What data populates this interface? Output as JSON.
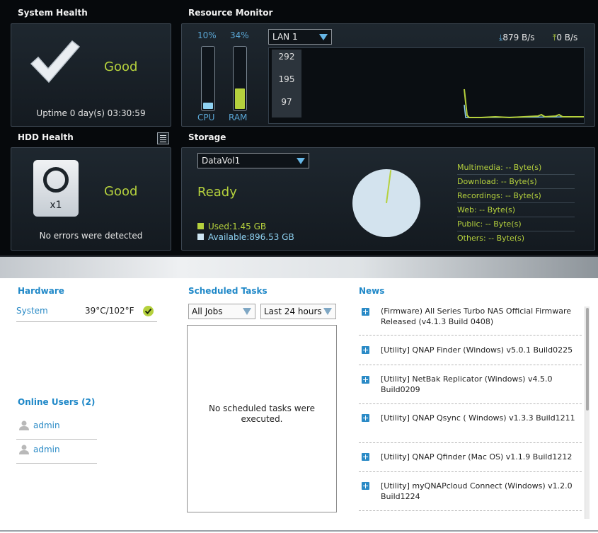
{
  "system_health": {
    "title": "System Health",
    "status": "Good",
    "uptime": "Uptime 0 day(s) 03:30:59"
  },
  "resource_monitor": {
    "title": "Resource Monitor",
    "cpu": {
      "percent": "10%",
      "label": "CPU",
      "value": 0.1
    },
    "ram": {
      "percent": "34%",
      "label": "RAM",
      "value": 0.34
    },
    "interface_select": "LAN 1",
    "download_rate": "879 B/s",
    "upload_rate": "0 B/s",
    "chart_ticks": [
      "292",
      "195",
      "97"
    ]
  },
  "hdd_health": {
    "title": "HDD Health",
    "status": "Good",
    "disk_count": "x1",
    "message": "No errors were detected"
  },
  "storage": {
    "title": "Storage",
    "volume_select": "DataVol1",
    "status": "Ready",
    "used": "Used:1.45 GB",
    "available": "Available:896.53 GB",
    "used_fraction": 0.0016,
    "categories": [
      "Multimedia: -- Byte(s)",
      "Download: -- Byte(s)",
      "Recordings: -- Byte(s)",
      "Web: -- Byte(s)",
      "Public: -- Byte(s)",
      "Others: -- Byte(s)"
    ]
  },
  "hardware": {
    "title": "Hardware",
    "system_label": "System",
    "temperature": "39°C/102°F"
  },
  "online_users": {
    "title": "Online Users (2)",
    "users": [
      "admin",
      "admin"
    ]
  },
  "scheduled_tasks": {
    "title": "Scheduled Tasks",
    "job_filter": "All Jobs",
    "time_filter": "Last 24 hours",
    "empty_message": "No scheduled tasks were executed."
  },
  "news": {
    "title": "News",
    "items": [
      "(Firmware) All Series Turbo NAS Official Firmware Released (v4.1.3 Build 0408)",
      "[Utility] QNAP Finder (Windows) v5.0.1 Build0225",
      "[Utility] NetBak Replicator (Windows) v4.5.0 Build0209",
      "[Utility] QNAP Qsync ( Windows) v1.3.3 Build1211",
      "[Utility] QNAP Qfinder (Mac OS) v1.1.9 Build1212",
      "[Utility] myQNAPcloud Connect (Windows) v1.2.0 Build1224"
    ]
  },
  "colors": {
    "accent_green": "#b5d13d",
    "accent_blue": "#5aa6d4",
    "link_blue": "#2a8ac6"
  }
}
